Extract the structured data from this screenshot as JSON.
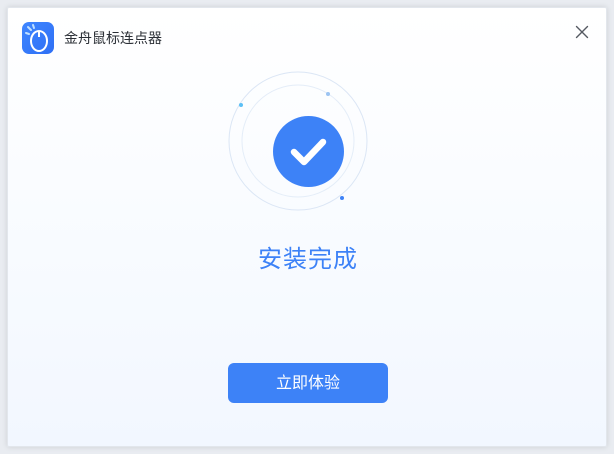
{
  "window": {
    "title": "金舟鼠标连点器"
  },
  "main": {
    "status_title": "安装完成",
    "primary_button_label": "立即体验"
  },
  "colors": {
    "accent": "#3d82f7",
    "title_text": "#2b2f36",
    "ring": "#d9e6f7"
  },
  "icons": {
    "app_logo": "mouse-icon",
    "close": "close-icon",
    "status": "checkmark-icon"
  }
}
